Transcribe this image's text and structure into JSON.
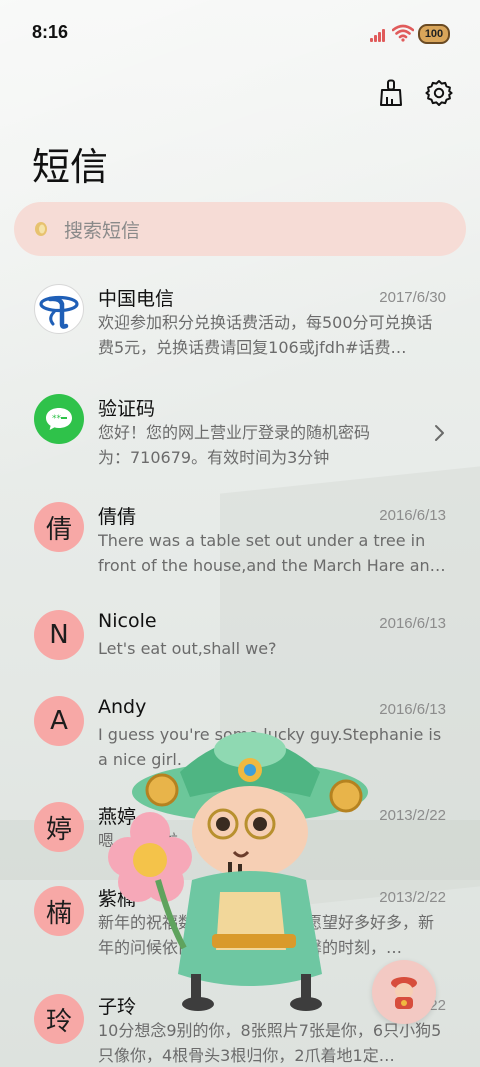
{
  "status_bar": {
    "time": "8:16",
    "battery": "100",
    "signal_color": "#e05b5b",
    "wifi_color": "#e05b5b"
  },
  "header": {
    "title": "短信",
    "actions": [
      "clean-icon",
      "gear-icon"
    ]
  },
  "search": {
    "placeholder": "搜索短信",
    "bg_color": "#f6dcd6"
  },
  "conversations": [
    {
      "name": "中国电信",
      "date": "2017/6/30",
      "avatar_type": "china-telecom-logo",
      "preview": "欢迎参加积分兑换话费活动，每500分可兑换话费5元，兑换话费请回复106或jfdh#话费…"
    },
    {
      "name": "验证码",
      "date": "",
      "avatar_type": "message-icon",
      "preview": "您好！您的网上营业厅登录的随机密码为：710679。有效时间为3分钟",
      "has_chevron": true
    },
    {
      "name": "倩倩",
      "date": "2016/6/13",
      "avatar_text": "倩",
      "preview": "There was a table set out under a tree in front of the house,and the March Hare an…"
    },
    {
      "name": "Nicole",
      "date": "2016/6/13",
      "avatar_text": "N",
      "preview": "Let's eat out,shall we?"
    },
    {
      "name": "Andy",
      "date": "2016/6/13",
      "avatar_text": "A",
      "preview": "I guess you're some lucky guy.Stephanie is a nice girl."
    },
    {
      "name": "燕婷",
      "date": "2013/2/22",
      "avatar_text": "婷",
      "preview": "嗯。收到啦。同乐同乐。"
    },
    {
      "name": "紫楠",
      "date": "2013/2/22",
      "avatar_text": "楠",
      "preview": "新年的祝福数不胜数，新年的愿望好多好多，新年的问候依旧美好，在这个温馨的时刻，…"
    },
    {
      "name": "子玲",
      "date": "2013/2/22",
      "avatar_text": "玲",
      "preview": "10分想念9别的你，8张照片7张是你，6只小狗5只像你，4根骨头3根归你，2爪着地1定…"
    }
  ],
  "colors": {
    "avatar_bg": "#f7a8a6",
    "accent_green": "#2fc24a",
    "telecom_blue": "#1f5fb7"
  }
}
